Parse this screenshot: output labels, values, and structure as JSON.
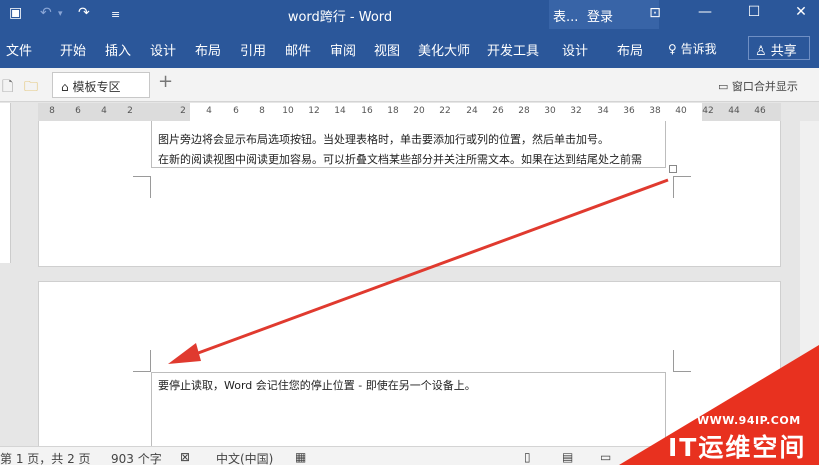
{
  "titlebar": {
    "title": "word跨行 - Word",
    "context_title": "表...",
    "login": "登录"
  },
  "ribbon_tabs": [
    "文件",
    "开始",
    "插入",
    "设计",
    "布局",
    "引用",
    "邮件",
    "审阅",
    "视图",
    "美化大师",
    "开发工具",
    "设计",
    "布局"
  ],
  "tellme": "告诉我",
  "share": "共享",
  "tabstrip": {
    "doc_tab": "模板专区",
    "add": "+",
    "merge_windows": "窗口合并显示"
  },
  "ruler_ticks": [
    "8",
    "6",
    "4",
    "2",
    "2",
    "4",
    "6",
    "8",
    "10",
    "12",
    "14",
    "16",
    "18",
    "20",
    "22",
    "24",
    "26",
    "28",
    "30",
    "32",
    "34",
    "36",
    "38",
    "40",
    "42",
    "44",
    "46"
  ],
  "document": {
    "page1_line1": "图片旁边将会显示布局选项按钮。当处理表格时，单击要添加行或列的位置，然后单击加号。",
    "page1_line2": "在新的阅读视图中阅读更加容易。可以折叠文档某些部分并关注所需文本。如果在达到结尾处之前需",
    "page2_line1": "要停止读取，Word 会记住您的停止位置 - 即使在另一个设备上。"
  },
  "status": {
    "page": "第 1 页，共 2 页",
    "words": "903 个字",
    "language": "中文(中国)"
  },
  "watermark": {
    "url": "WWW.94IP.COM",
    "brand": "IT运维空间"
  },
  "colors": {
    "ribbon": "#2b579a",
    "arrow": "#e03a2f",
    "watermark": "#e8311f"
  }
}
